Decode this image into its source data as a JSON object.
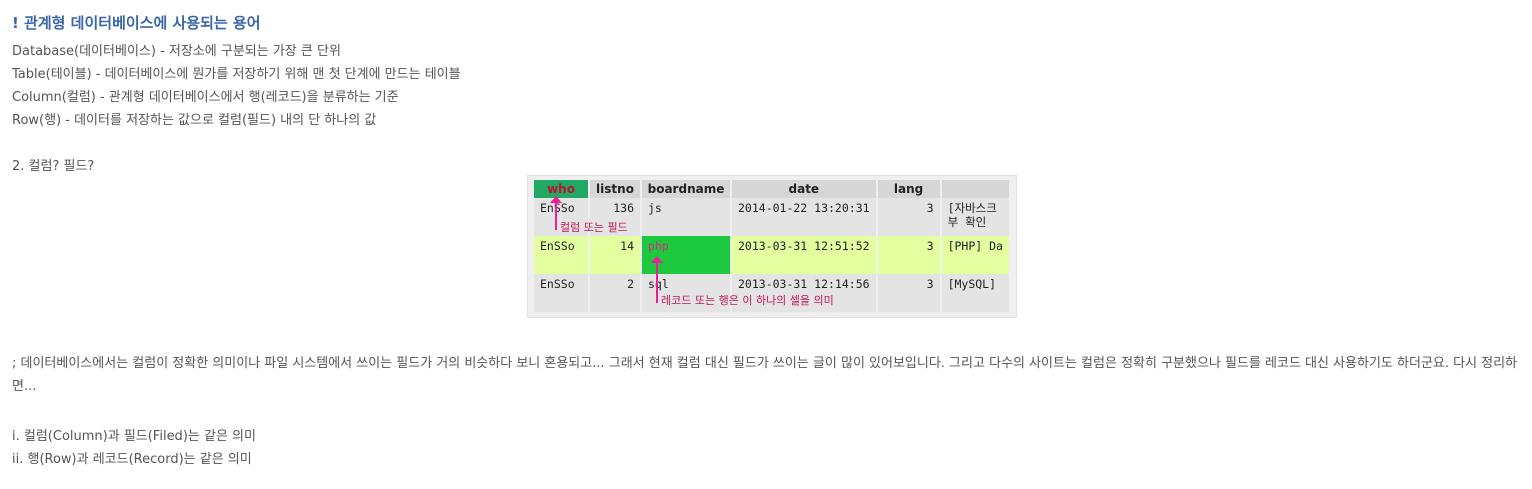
{
  "heading": "! 관계형 데이터베이스에 사용되는 용어",
  "definitions": [
    "Database(데이터베이스) - 저장소에 구분되는 가장 큰 단위",
    "Table(테이블) - 데이터베이스에 뭔가를 저장하기 위해 맨 첫 단계에 만드는 테이블",
    "Column(컬럼) - 관계형 데이터베이스에서 행(레코드)을 분류하는 기준",
    "Row(행) - 데이터를 저장하는 값으로 컬럼(필드) 내의 단 하나의 값"
  ],
  "section_title": "2. 컬럼? 필드?",
  "table": {
    "headers": [
      "who",
      "listno",
      "boardname",
      "date",
      "lang",
      ""
    ],
    "rows": [
      [
        "EnSSo",
        "136",
        "js",
        "2014-01-22 13:20:31",
        "3",
        "[자바스크\n부 확인"
      ],
      [
        "EnSSo",
        "14",
        "php",
        "2013-03-31 12:51:52",
        "3",
        "[PHP] Da"
      ],
      [
        "EnSSo",
        "2",
        "sql",
        "2013-03-31 12:14:56",
        "3",
        "[MySQL]"
      ]
    ],
    "annotation_column": "컬럼 또는 필드",
    "annotation_cell": "레코드 또는 행은 이 하나의 셀을 의미"
  },
  "paragraph": "; 데이터베이스에서는 컬럼이 정확한 의미이나 파일 시스템에서 쓰이는 필드가 거의 비슷하다 보니 혼용되고... 그래서 현재 컬럼 대신 필드가 쓰이는 글이 많이 있어보입니다. 그리고 다수의 사이트는 컬럼은 정확히 구분했으나 필드를 레코드 대신 사용하기도 하더군요. 다시 정리하면...",
  "summary": [
    "i. 컬럼(Column)과 필드(Filed)는 같은 의미",
    "ii. 행(Row)과 레코드(Record)는 같은 의미"
  ],
  "colors": {
    "heading": "#3a67a8",
    "highlight_row": "#e3ffa0",
    "selected_cell": "#1dc93c",
    "annotation": "#c2185b"
  }
}
